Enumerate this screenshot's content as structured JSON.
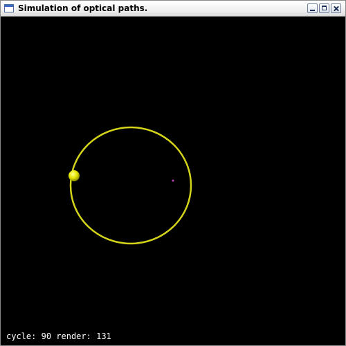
{
  "window": {
    "title": "Simulation of optical paths."
  },
  "icons": {
    "app": "window-icon",
    "minimize": "minimize-icon",
    "maximize": "maximize-icon",
    "close": "close-icon"
  },
  "colors": {
    "background": "#000000",
    "orbit": "#d4d41a",
    "particle": "#e6e600",
    "center_point": "#c040c0",
    "status_text": "#ffffff"
  },
  "status": {
    "cycle_label": "cycle:",
    "cycle_value": "90",
    "render_label": "render:",
    "render_value": "131"
  }
}
